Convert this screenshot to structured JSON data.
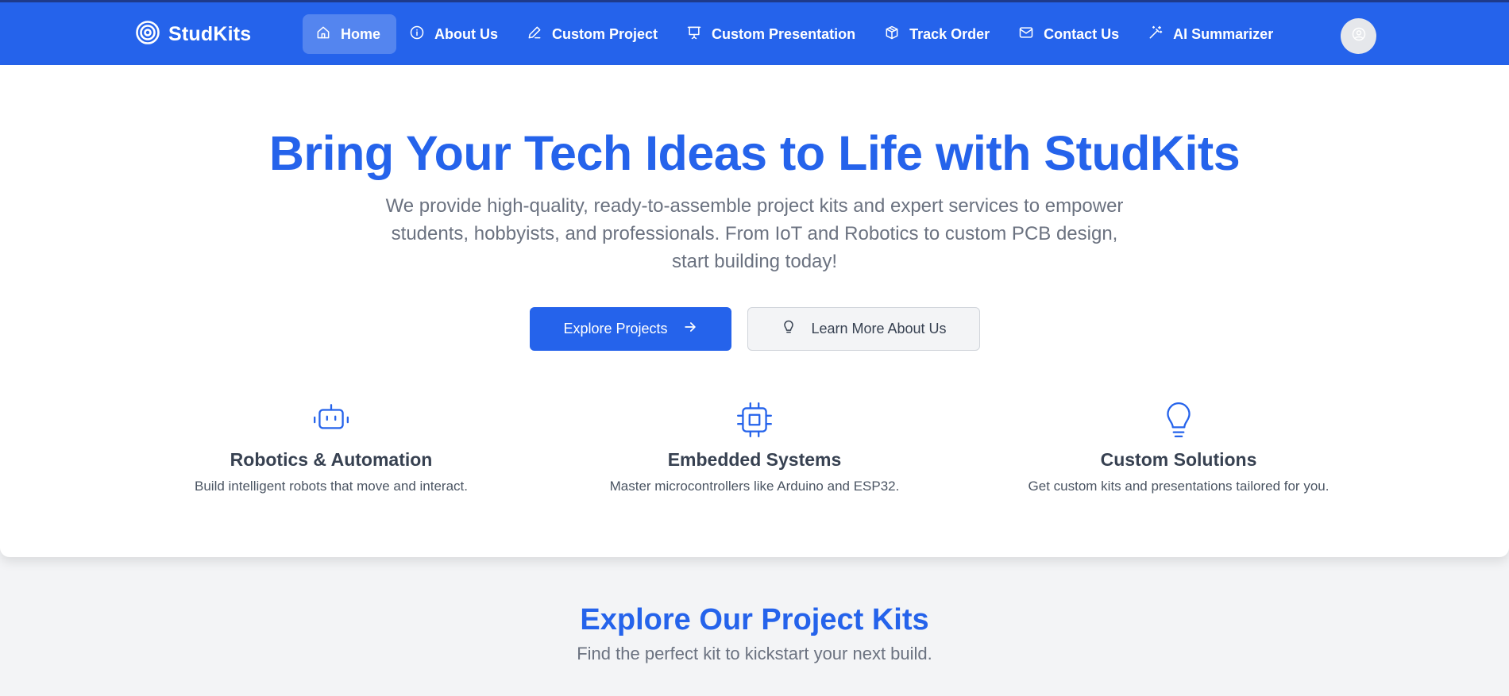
{
  "brand": {
    "name": "StudKits",
    "icon": "target-icon"
  },
  "nav": {
    "items": [
      {
        "label": "Home",
        "icon": "home-icon",
        "active": true
      },
      {
        "label": "About Us",
        "icon": "info-icon"
      },
      {
        "label": "Custom Project",
        "icon": "pencil-icon"
      },
      {
        "label": "Custom Presentation",
        "icon": "presentation-icon"
      },
      {
        "label": "Track Order",
        "icon": "package-icon"
      },
      {
        "label": "Contact Us",
        "icon": "mail-icon"
      },
      {
        "label": "AI Summarizer",
        "icon": "magic-wand-icon"
      }
    ],
    "avatar_icon": "user-circle-icon"
  },
  "hero": {
    "title": "Bring Your Tech Ideas to Life with StudKits",
    "subtitle": "We provide high-quality, ready-to-assemble project kits and expert services to empower students, hobbyists, and professionals. From IoT and Robotics to custom PCB design, start building today!",
    "primary_button": "Explore Projects",
    "secondary_button": "Learn More About Us"
  },
  "features": [
    {
      "title": "Robotics & Automation",
      "desc": "Build intelligent robots that move and interact.",
      "icon": "robot-icon"
    },
    {
      "title": "Embedded Systems",
      "desc": "Master microcontrollers like Arduino and ESP32.",
      "icon": "chip-icon"
    },
    {
      "title": "Custom Solutions",
      "desc": "Get custom kits and presentations tailored for you.",
      "icon": "lightbulb-icon"
    }
  ],
  "projects_section": {
    "title": "Explore Our Project Kits",
    "subtitle": "Find the perfect kit to kickstart your next build."
  },
  "colors": {
    "primary": "#2563eb",
    "header_border": "#1e3a8a",
    "page_bg": "#f3f4f6",
    "muted_text": "#6b7280"
  }
}
